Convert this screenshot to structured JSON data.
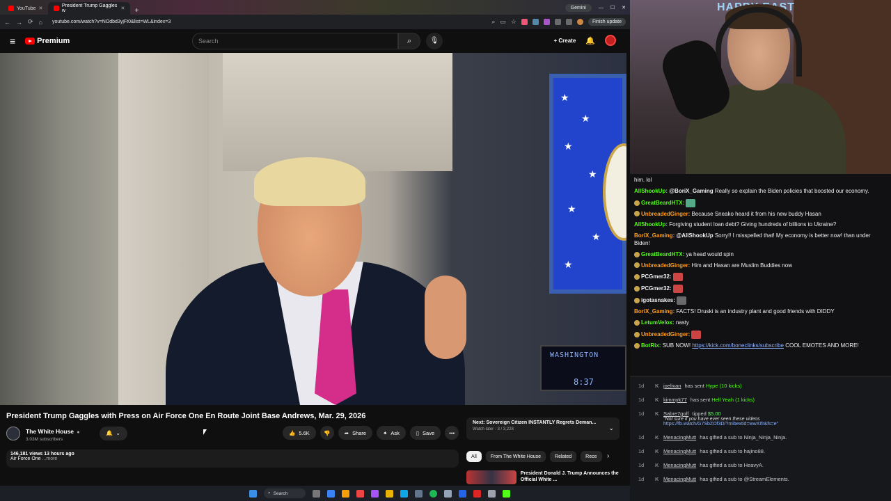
{
  "browser": {
    "tabs": [
      {
        "label": "YouTube",
        "active": false
      },
      {
        "label": "President Trump Gaggles w",
        "active": true
      }
    ],
    "gemini_label": "Gemini",
    "url": "youtube.com/watch?v=NOdbd3yjFt0&list=WL&index=3",
    "finish_update_label": "Finish update"
  },
  "youtube": {
    "logo_label": "Premium",
    "search_placeholder": "Search",
    "create_label": "Create",
    "video_title": "President Trump Gaggles with Press on Air Force One En Route Joint Base Andrews, Mar. 29, 2026",
    "video_overlay": {
      "clock_city": "WASHINGTON",
      "clock_time": "8:37"
    },
    "channel": {
      "name": "The White House",
      "subs": "3.03M subscribers"
    },
    "actions": {
      "likes": "5.6K",
      "share": "Share",
      "ask": "Ask",
      "save": "Save"
    },
    "description": {
      "stats": "146,181 views  13 hours ago",
      "snippet": "Air Force One",
      "more": "...more"
    },
    "next": {
      "title": "Next: Sovereign Citizen INSTANTLY Regrets Deman...",
      "sub": "Watch later - 3 / 3,228"
    },
    "chips": [
      "All",
      "From The White House",
      "Related",
      "Rece"
    ],
    "rec_item": {
      "title": "President Donald J. Trump Announces the Official White ..."
    }
  },
  "taskbar": {
    "search_label": "Search"
  },
  "webcam": {
    "sign": "HAPPY EAST"
  },
  "chat": [
    {
      "user": "",
      "text": "him. lol",
      "color": "#efeff1"
    },
    {
      "user": "AllShookUp:",
      "mention": "@BoriX_Gaming",
      "text": " Really so explain the Biden policies that boosted our economy.",
      "color": "#53fc18"
    },
    {
      "user": "GreatBeardHTX:",
      "text": "",
      "color": "#53fc18",
      "emote": "car",
      "badge": true
    },
    {
      "user": "UnbreadedGinger:",
      "text": " Because Sneako heard it from his new buddy Hasan",
      "color": "#ff9f1c",
      "badge": true
    },
    {
      "user": "AllShookUp:",
      "text": " Forgiving student loan debt? Giving hundreds of billions to Ukraine?",
      "color": "#53fc18"
    },
    {
      "user": "BoriX_Gaming:",
      "mention": "@AllShookUp",
      "text": " Sorry!! I misspelled that! My economy is better now! than under Biden!",
      "color": "#ff9f1c"
    },
    {
      "user": "GreatBeardHTX:",
      "text": " ya head would spin",
      "color": "#53fc18",
      "badge": true
    },
    {
      "user": "UnbreadedGinger:",
      "text": " Him and Hasan are Muslim Buddies now",
      "color": "#ff9f1c",
      "badge": true
    },
    {
      "user": "PCGmer32:",
      "text": "",
      "color": "#efeff1",
      "emote": "red",
      "badge": true
    },
    {
      "user": "PCGmer32:",
      "text": "",
      "color": "#efeff1",
      "emote": "red",
      "badge": true
    },
    {
      "user": "igotasnakes:",
      "text": "",
      "color": "#efeff1",
      "emote": "alt",
      "badge": true
    },
    {
      "user": "BoriX_Gaming:",
      "text": " FACTS! Druski is an industry plant and good friends with DIDDY",
      "color": "#ff9f1c"
    },
    {
      "user": "LetumVelox:",
      "text": " nasty",
      "color": "#53fc18",
      "badge": true
    },
    {
      "user": "UnbreadedGinger:",
      "text": "",
      "color": "#ff9f1c",
      "emote": "red",
      "badge": true
    },
    {
      "user": "BotRix:",
      "text": " SUB NOW! ",
      "link": "https://kick.com/boneclinks/subscribe",
      "tail": " COOL EMOTES AND MORE!",
      "color": "#53fc18",
      "badge": true
    }
  ],
  "events": [
    {
      "time": "1d",
      "user": "joelivan",
      "action": " has sent ",
      "highlight": "Hype (10 kicks)"
    },
    {
      "time": "1d",
      "user": "kimmyk77",
      "action": " has sent ",
      "highlight": "Hell Yeah (1 kicks)"
    },
    {
      "time": "1d",
      "user": "Sabre7golf",
      "action": " tipped ",
      "highlight": "$5.00",
      "msg": "\"Not sure if you have ever seen these videos",
      "link": "https://fb.watch/G7SbZOf3D/?mibextid=wwXIfr&fs=e\""
    },
    {
      "time": "1d",
      "user": "MenacingMutt",
      "action": " has gifted a sub to ",
      "target": "Ninja_Ninja_Ninja."
    },
    {
      "time": "1d",
      "user": "MenacingMutt",
      "action": " has gifted a sub to ",
      "target": "hajino88."
    },
    {
      "time": "1d",
      "user": "MenacingMutt",
      "action": " has gifted a sub to ",
      "target": "HeavyA."
    },
    {
      "time": "1d",
      "user": "MenacingMutt",
      "action": " has gifted a sub to ",
      "target": "@StreamElements."
    }
  ],
  "colors": {
    "yt_red": "#ff0000",
    "kick_green": "#53fc18",
    "tie_pink": "#d42d8a"
  }
}
